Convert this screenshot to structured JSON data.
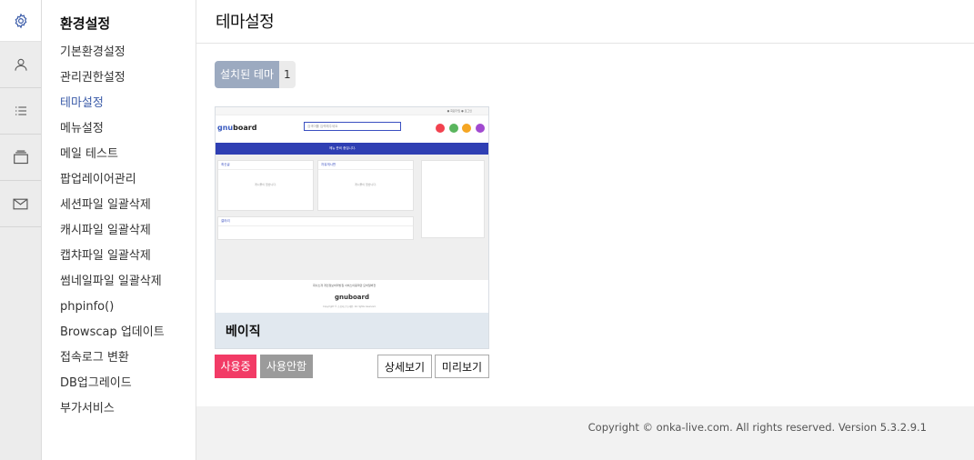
{
  "rail": {
    "icons": [
      "gear-icon",
      "user-icon",
      "list-icon",
      "layers-icon",
      "mail-icon"
    ]
  },
  "menu": {
    "title": "환경설정",
    "items": [
      {
        "label": "기본환경설정",
        "active": false
      },
      {
        "label": "관리권한설정",
        "active": false
      },
      {
        "label": "테마설정",
        "active": true
      },
      {
        "label": "메뉴설정",
        "active": false
      },
      {
        "label": "메일 테스트",
        "active": false
      },
      {
        "label": "팝업레이어관리",
        "active": false
      },
      {
        "label": "세션파일 일괄삭제",
        "active": false
      },
      {
        "label": "캐시파일 일괄삭제",
        "active": false
      },
      {
        "label": "캡챠파일 일괄삭제",
        "active": false
      },
      {
        "label": "썸네일파일 일괄삭제",
        "active": false
      },
      {
        "label": "phpinfo()",
        "active": false
      },
      {
        "label": "Browscap 업데이트",
        "active": false
      },
      {
        "label": "접속로그 변환",
        "active": false
      },
      {
        "label": "DB업그레이드",
        "active": false
      },
      {
        "label": "부가서비스",
        "active": false
      }
    ]
  },
  "page": {
    "title": "테마설정",
    "installed_label": "설치된 테마",
    "installed_count": "1"
  },
  "theme_card": {
    "name": "베이직",
    "buttons": {
      "in_use": "사용중",
      "not_use": "사용안함",
      "detail": "상세보기",
      "preview": "미리보기"
    }
  },
  "thumbnail": {
    "logo_prefix": "gnu",
    "logo_suffix": "board",
    "search_placeholder": "검색어를 입력해주세요",
    "nav_text": "메뉴 준비 중입니다.",
    "box1_title": "최신글",
    "box2_title": "자유게시판",
    "box3_title": "갤러리",
    "empty_text": "게시물이 없습니다.",
    "footer_links": "회사소개   개인정보처리방침   서비스이용약관   모바일버전",
    "footer_logo": "gnuboard",
    "footer_copy": "Copyright © 소유하신 도메인. All rights reserved."
  },
  "footer": {
    "copyright": "Copyright © onka-live.com. All rights reserved. Version 5.3.2.9.1"
  },
  "colors": {
    "accent_active": "#3a5ba8",
    "in_use_button": "#f23b66",
    "not_use_button": "#9b9b9b",
    "installed_badge": "#9caac0",
    "thumb_nav": "#2f3fb3"
  }
}
